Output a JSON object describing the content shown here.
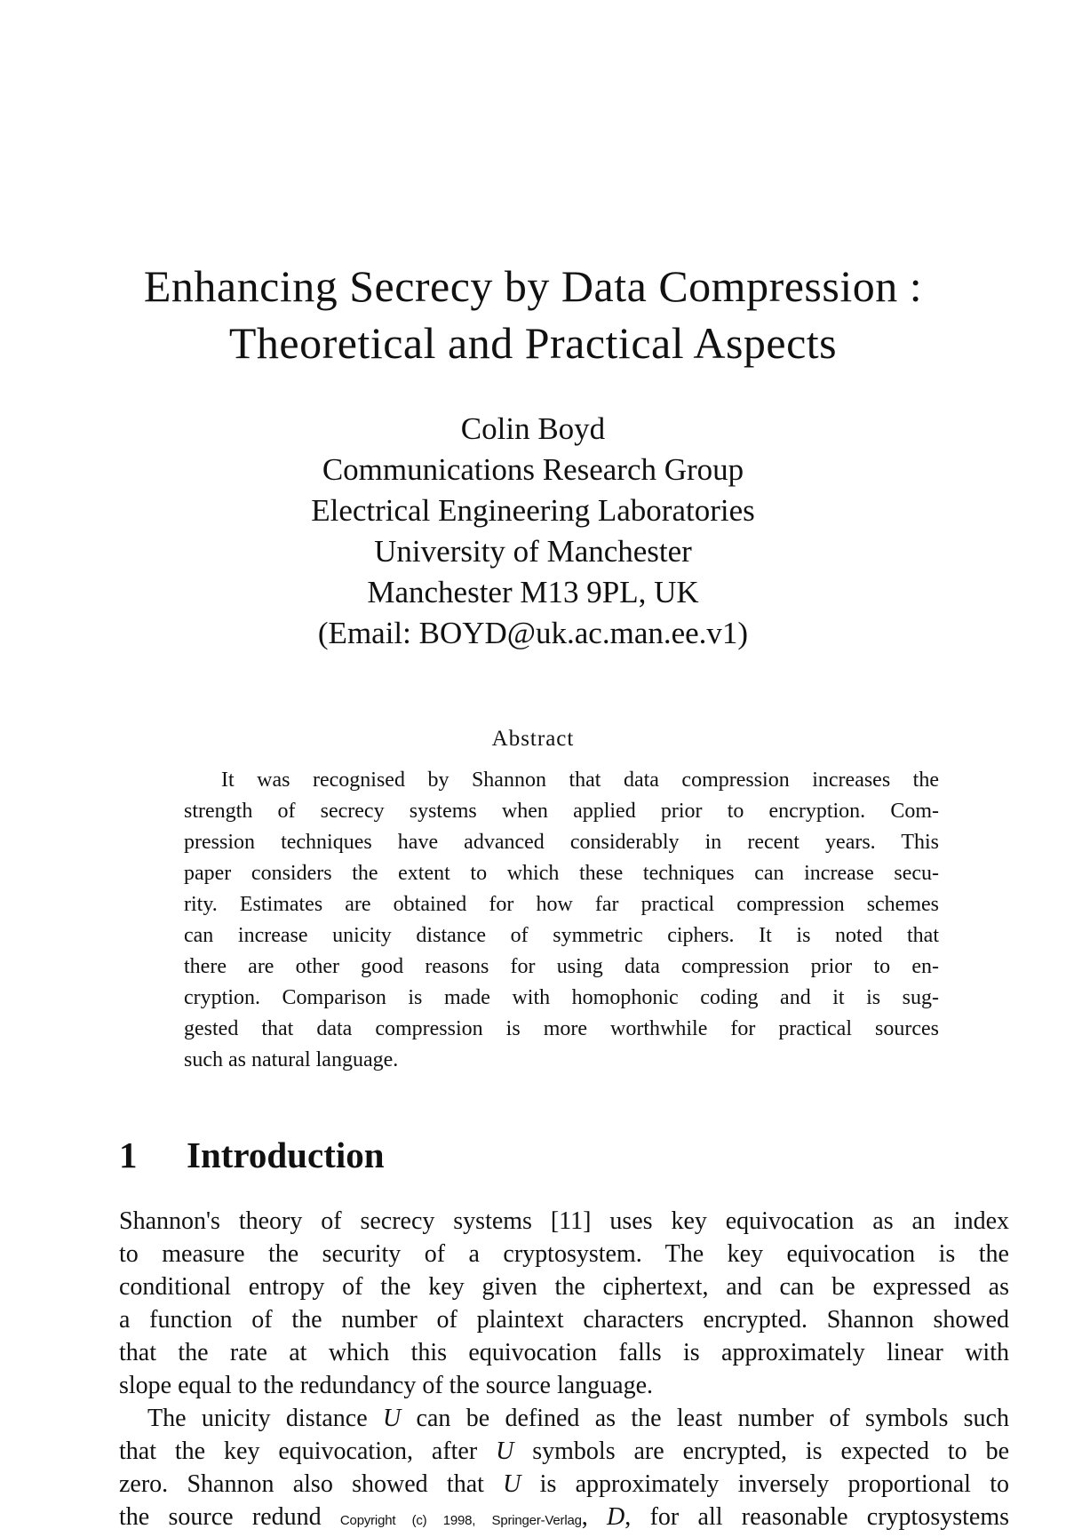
{
  "paper": {
    "title_lines": [
      "Enhancing Secrecy by Data Compression :",
      "Theoretical and Practical Aspects"
    ],
    "author": {
      "name": "Colin Boyd",
      "affiliation_lines": [
        "Communications Research Group",
        "Electrical Engineering Laboratories",
        "University of Manchester",
        "Manchester M13 9PL, UK",
        "(Email: BOYD@uk.ac.man.ee.v1)"
      ]
    },
    "abstract": {
      "heading": "Abstract",
      "lines": [
        "It was recognised by Shannon that data compression increases the",
        "strength of secrecy systems when applied prior to encryption. Com-",
        "pression techniques have advanced considerably in recent years. This",
        "paper considers the extent to which these techniques can increase secu-",
        "rity. Estimates are obtained for how far practical compression schemes",
        "can increase unicity distance of symmetric ciphers. It is noted that",
        "there are other good reasons for using data compression prior to en-",
        "cryption. Comparison is made with homophonic coding and it is sug-",
        "gested that data compression is more worthwhile for practical sources",
        "such as natural language."
      ]
    },
    "section": {
      "number": "1",
      "title": "Introduction",
      "paragraph1_lines": [
        "Shannon's theory of secrecy systems [11] uses key equivocation as an index",
        "to measure the security of a cryptosystem. The key equivocation is the",
        "conditional entropy of the key given the ciphertext, and can be expressed as",
        "a function of the number of plaintext characters encrypted. Shannon showed",
        "that the rate at which this equivocation falls is approximately linear with",
        "slope equal to the redundancy of the source language."
      ],
      "paragraph2": {
        "line1_before": "The unicity distance ",
        "line1_var": "U",
        "line1_after": " can be defined as the least number of symbols such",
        "line2_before": "that the key equivocation, after ",
        "line2_var": "U",
        "line2_after": " symbols are encrypted, is expected to be",
        "line3_before": "zero. Shannon also showed that ",
        "line3_var": "U",
        "line3_after": " is approximately inversely proportional to",
        "line4_before": "the source redund",
        "line4_var": "D",
        "line4_after": ", for all reasonable cryptosystems"
      }
    },
    "copyright_notice": "Copyright (c) 1998, Springer-Verlag"
  }
}
